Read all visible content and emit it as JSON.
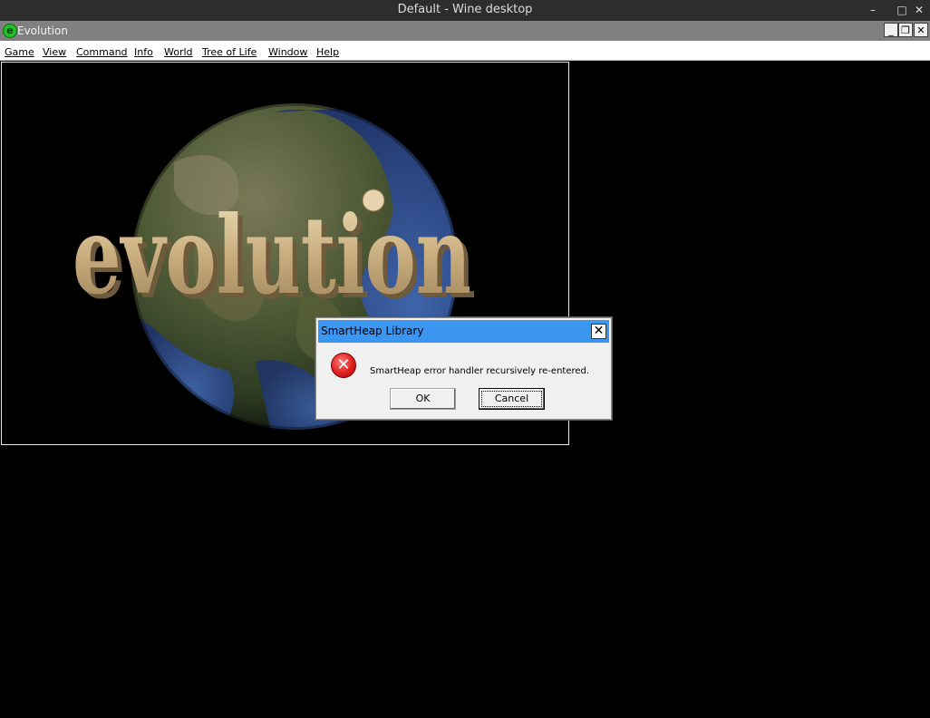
{
  "host": {
    "title": "Default - Wine desktop",
    "controls": {
      "minimize": "–",
      "maximize": "□",
      "close": "✕"
    }
  },
  "app": {
    "title": "Evolution",
    "logo_letter": "e",
    "controls": {
      "minimize": "_",
      "restore": "❐",
      "close": "✕"
    }
  },
  "menu": {
    "items": [
      "Game",
      "View",
      "Command",
      "Info",
      "World",
      "Tree of Life",
      "Window",
      "Help"
    ]
  },
  "splash": {
    "logo_text": "evolution"
  },
  "dialog": {
    "title": "SmartHeap Library",
    "close_label": "✕",
    "icon_glyph": "✕",
    "message": "SmartHeap error handler recursively re-entered.",
    "ok_label": "OK",
    "cancel_label": "Cancel"
  },
  "colors": {
    "dialog_titlebar": "#3b96f2",
    "error_red": "#e01f1f",
    "logo_green": "#22c02a"
  }
}
